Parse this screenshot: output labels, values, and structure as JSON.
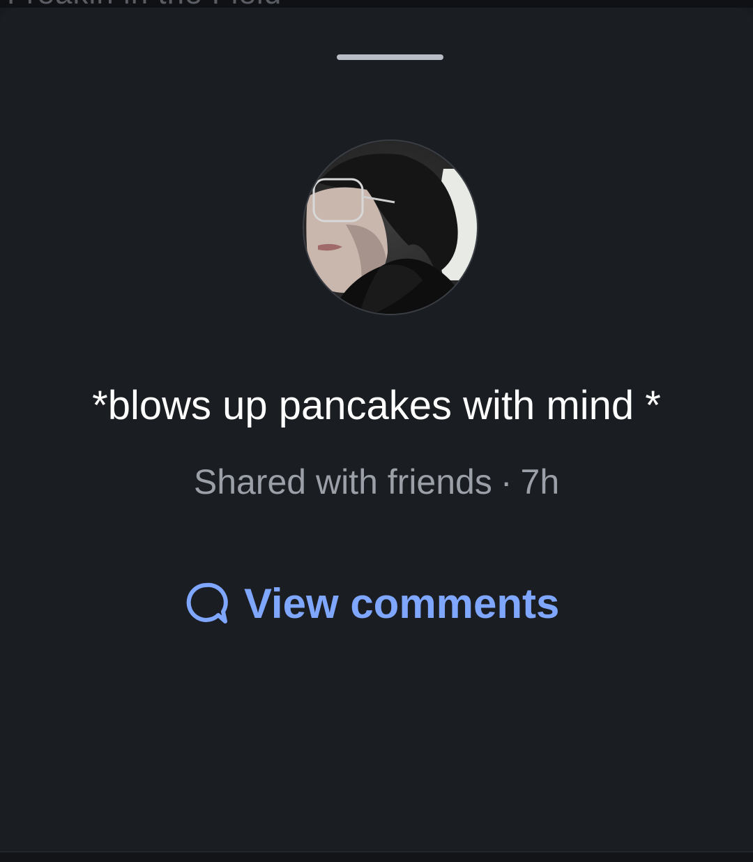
{
  "background_title": "Freakin in the Field",
  "post": {
    "caption": "*blows up pancakes with mind *",
    "audience": "Shared with friends",
    "separator": "·",
    "time_ago": "7h"
  },
  "actions": {
    "view_comments_label": "View comments",
    "view_comments_icon": "chat-bubble-icon"
  },
  "colors": {
    "sheet_background": "#1a1d21",
    "accent": "#7fa7ff",
    "text_primary": "#ffffff",
    "text_secondary": "#9ba0a8"
  }
}
